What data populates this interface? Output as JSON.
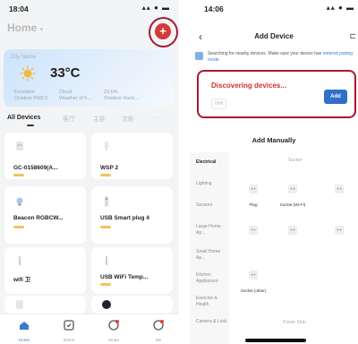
{
  "left": {
    "status": {
      "time": "18:04",
      "icons": "▴▴ ● ▬"
    },
    "home_title": "Home",
    "weather": {
      "city": "City Name",
      "temp": "33°C",
      "stats": [
        {
          "value": "Excellent",
          "label": "Outdoor PM2.5"
        },
        {
          "value": "Cloud",
          "label": "Weather of h..."
        },
        {
          "value": "23.6%",
          "label": "Outdoor Humi..."
        }
      ]
    },
    "tabs": [
      "All Devices",
      "客厅",
      "主卧",
      "次卧",
      "···"
    ],
    "devices": [
      {
        "name": "",
        "icon": "plug-icon"
      },
      {
        "name": "",
        "icon": "lamp-icon"
      },
      {
        "name": "GC-0158609(A...",
        "icon": "plug-icon"
      },
      {
        "name": "WSP 2",
        "icon": "lamp-icon"
      },
      {
        "name": "Beacon RGBCW...",
        "icon": "bulb-icon"
      },
      {
        "name": "USB Smart plug 4",
        "icon": "usb-plug-icon"
      },
      {
        "name": "wifi 卫",
        "icon": "lamp-icon"
      },
      {
        "name": "USB WiFi Temp...",
        "icon": "sensor-icon"
      },
      {
        "name": "",
        "icon": "plug-icon"
      },
      {
        "name": "",
        "icon": "camera-icon"
      }
    ],
    "nav": [
      "Home",
      "Scene",
      "Smart",
      "Me"
    ]
  },
  "right": {
    "status": {
      "time": "14:06",
      "icons": "▴▴ ● ▬"
    },
    "title": "Add Device",
    "hint": "Searching for nearby devices. Make sure your device has",
    "hint_link": "entered pairing mode.",
    "discover_title": "Discovering devices...",
    "discover_item": "Wifi",
    "add_button": "Add",
    "manual_title": "Add Manually",
    "categories": [
      "Electrical",
      "Lighting",
      "Sensors",
      "Large Home Ap...",
      "Small Home Ap...",
      "Kitchen Appliances",
      "Exercise & Health",
      "Camera & Lock"
    ],
    "brand_labels": [
      "Socket"
    ],
    "tiles": [
      {
        "label": "Plug"
      },
      {
        "label": "Socket (Wi-Fi)"
      },
      {
        "label": ""
      },
      {
        "label": ""
      },
      {
        "label": ""
      },
      {
        "label": ""
      },
      {
        "label": "Socket (other)"
      }
    ],
    "power_strip_label": "Power Strip"
  }
}
